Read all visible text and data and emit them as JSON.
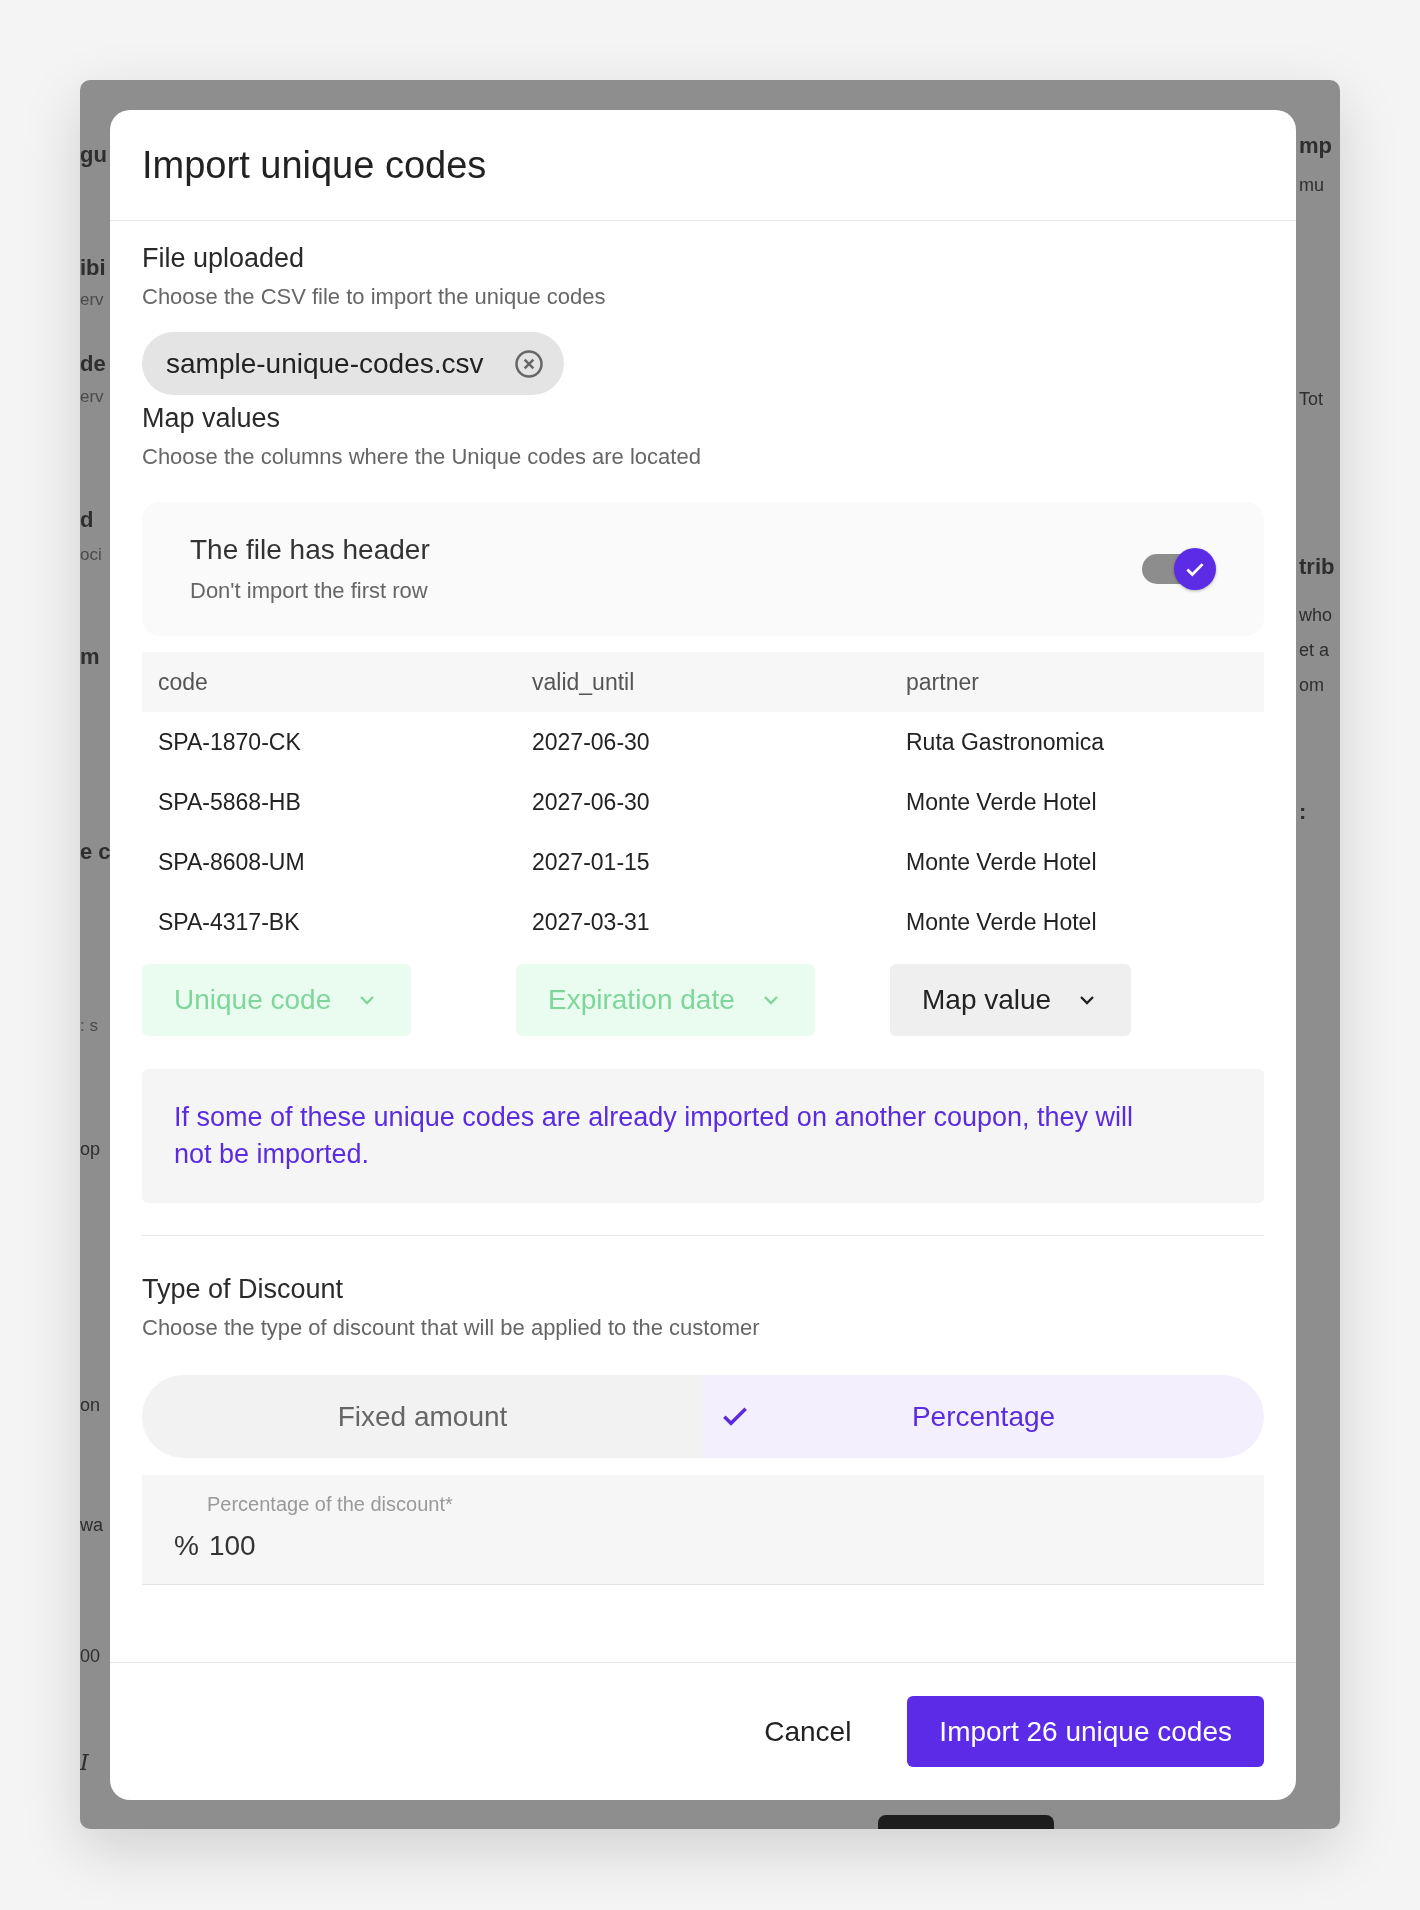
{
  "backdrop": {
    "left_fragments": [
      {
        "text": "gu",
        "kind": "bold"
      },
      {
        "text": "ibi",
        "kind": "bold"
      },
      {
        "text": "erv",
        "kind": "muted"
      },
      {
        "text": "de",
        "kind": "bold"
      },
      {
        "text": "erv",
        "kind": "muted"
      },
      {
        "text": "d",
        "kind": "bold"
      },
      {
        "text": "oci",
        "kind": "muted"
      },
      {
        "text": "m",
        "kind": "bold"
      },
      {
        "text": "e c",
        "kind": "bold"
      },
      {
        "text": ": s",
        "kind": "muted"
      },
      {
        "text": "op",
        "kind": "plain"
      },
      {
        "text": "on",
        "kind": "plain"
      },
      {
        "text": "wa",
        "kind": "plain"
      },
      {
        "text": "00",
        "kind": "plain"
      },
      {
        "text": "I",
        "kind": "italic"
      }
    ],
    "right_fragments": [
      {
        "text": "mp",
        "kind": "bold"
      },
      {
        "text": "mu",
        "kind": "plain"
      },
      {
        "text": "Tot",
        "kind": "plain"
      },
      {
        "text": "trib",
        "kind": "bold"
      },
      {
        "text": "who",
        "kind": "plain"
      },
      {
        "text": "et a",
        "kind": "plain"
      },
      {
        "text": "om",
        "kind": "plain"
      },
      {
        "text": ":",
        "kind": "bold"
      }
    ]
  },
  "dialog": {
    "title": "Import unique codes",
    "file_section": {
      "title": "File uploaded",
      "subtitle": "Choose the CSV file to import the unique codes",
      "file_chip": {
        "name": "sample-unique-codes.csv"
      }
    },
    "map_section": {
      "title": "Map values",
      "subtitle": "Choose the columns where the Unique codes are located",
      "header_toggle": {
        "title": "The file has header",
        "subtitle": "Don't import the first row",
        "on": true
      },
      "table": {
        "columns": [
          "code",
          "valid_until",
          "partner"
        ],
        "rows": [
          [
            "SPA-1870-CK",
            "2027-06-30",
            "Ruta Gastronomica"
          ],
          [
            "SPA-5868-HB",
            "2027-06-30",
            "Monte Verde Hotel"
          ],
          [
            "SPA-8608-UM",
            "2027-01-15",
            "Monte Verde Hotel"
          ],
          [
            "SPA-4317-BK",
            "2027-03-31",
            "Monte Verde Hotel"
          ]
        ]
      },
      "mappings": [
        {
          "label": "Unique code",
          "mapped": true
        },
        {
          "label": "Expiration date",
          "mapped": true
        },
        {
          "label": "Map value",
          "mapped": false
        }
      ]
    },
    "notice": "If some of these unique codes are already imported on another coupon, they will not be imported.",
    "discount": {
      "title": "Type of Discount",
      "subtitle": "Choose the type of discount that will be applied to the customer",
      "options": [
        {
          "label": "Fixed amount",
          "selected": false
        },
        {
          "label": "Percentage",
          "selected": true
        }
      ],
      "field": {
        "label": "Percentage of the discount*",
        "prefix": "%",
        "value": "100"
      }
    },
    "footer": {
      "cancel": "Cancel",
      "confirm": "Import 26 unique codes"
    }
  }
}
